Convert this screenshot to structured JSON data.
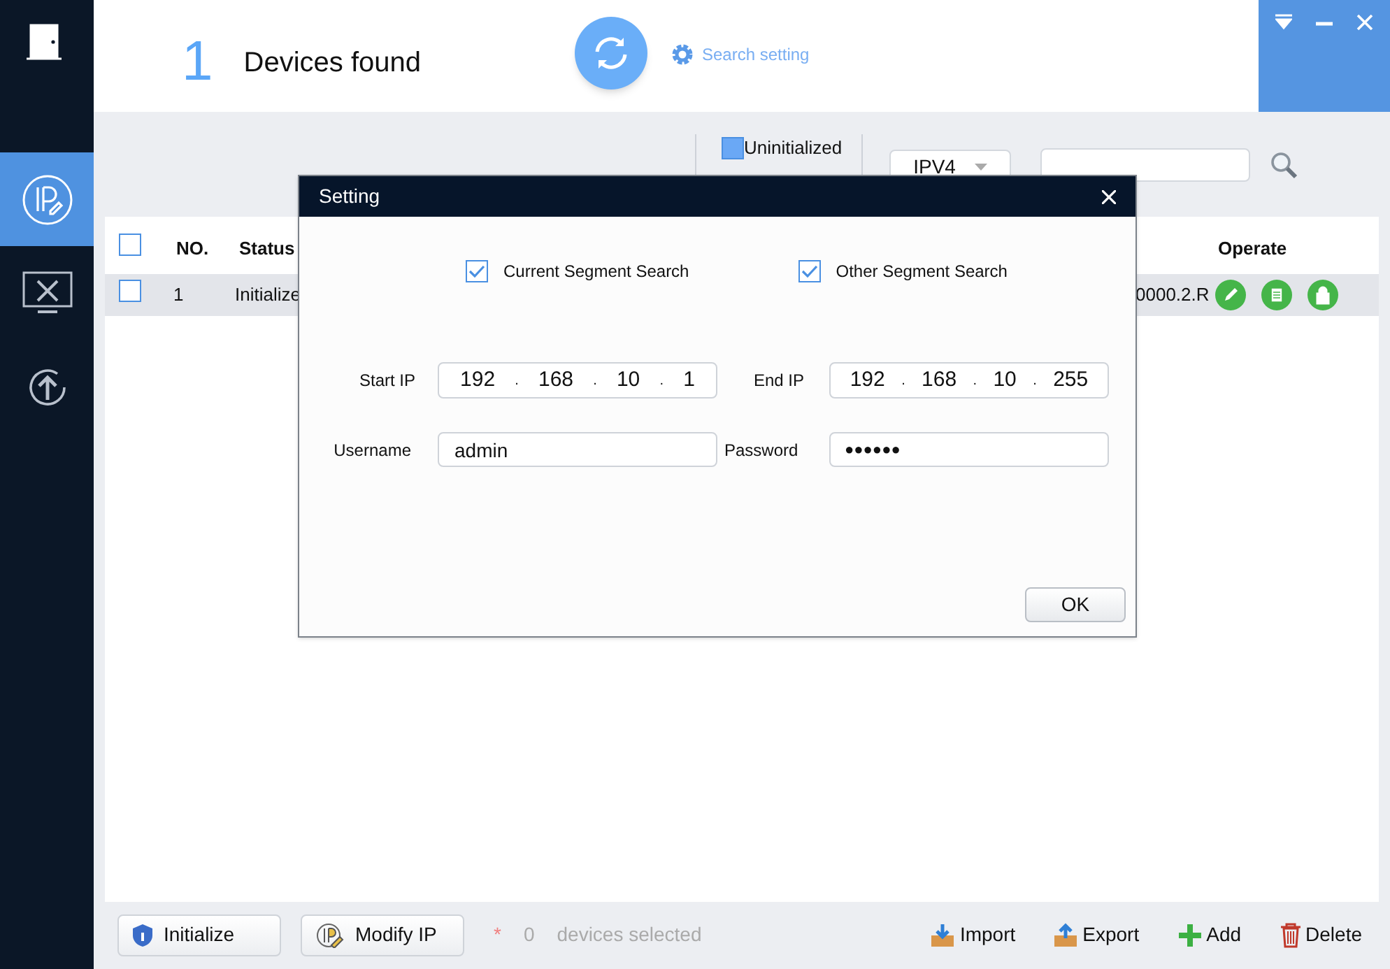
{
  "sidebar": {
    "items": [
      {
        "kind": "ip",
        "selected": true
      },
      {
        "kind": "tools",
        "selected": false
      },
      {
        "kind": "upgrade",
        "selected": false
      }
    ]
  },
  "header": {
    "count": "1",
    "title": "Devices found",
    "search_setting": "Search setting"
  },
  "filters": [
    {
      "label": "Uninitialized",
      "checked": true
    }
  ],
  "ip_version": {
    "value": "IPV4"
  },
  "table": {
    "all_checked": false,
    "columns": [
      {
        "label": "NO."
      },
      {
        "label": "Status"
      },
      {
        "label": "Operate"
      }
    ],
    "rows": [
      {
        "checked": false,
        "no": "1",
        "status": "Initialize",
        "version": "0000.2.R"
      }
    ]
  },
  "dialog": {
    "title": "Setting",
    "options": [
      {
        "label": "Current Segment Search",
        "checked": true
      },
      {
        "label": "Other Segment Search",
        "checked": true
      }
    ],
    "start_ip": {
      "label": "Start IP",
      "parts": [
        "192",
        "168",
        "10",
        "1"
      ],
      "separators": [
        ".",
        ".",
        "."
      ]
    },
    "end_ip": {
      "label": "End IP",
      "parts": [
        "192",
        "168",
        "10",
        "255"
      ],
      "separators": [
        ".",
        ".",
        "."
      ]
    },
    "username": {
      "label": "Username",
      "value": "admin"
    },
    "password": {
      "label": "Password",
      "value": "●●●●●●"
    },
    "ok": "OK"
  },
  "footer": {
    "left_buttons": [
      "Initialize",
      "Modify IP"
    ],
    "mark": "*",
    "selected_count": "0",
    "selected_text": "devices selected",
    "actions": [
      {
        "kind": "import",
        "label": "Import"
      },
      {
        "kind": "export",
        "label": "Export"
      },
      {
        "kind": "add",
        "label": "Add"
      },
      {
        "kind": "delete",
        "label": "Delete"
      }
    ]
  }
}
